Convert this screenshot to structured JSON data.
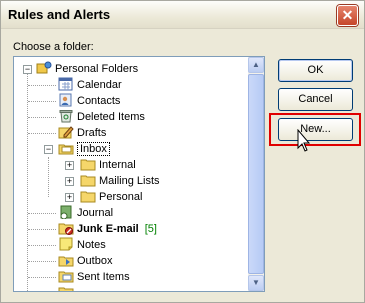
{
  "window": {
    "title": "Rules and Alerts"
  },
  "prompt": "Choose a folder:",
  "tree": {
    "root": "Personal Folders",
    "items": [
      {
        "label": "Calendar",
        "icon": "calendar-icon"
      },
      {
        "label": "Contacts",
        "icon": "contacts-icon"
      },
      {
        "label": "Deleted Items",
        "icon": "deleted-items-icon"
      },
      {
        "label": "Drafts",
        "icon": "drafts-icon"
      },
      {
        "label": "Inbox",
        "icon": "inbox-icon"
      },
      {
        "label": "Internal",
        "icon": "folder-icon"
      },
      {
        "label": "Mailing Lists",
        "icon": "folder-icon"
      },
      {
        "label": "Personal",
        "icon": "folder-icon"
      },
      {
        "label": "Journal",
        "icon": "journal-icon"
      },
      {
        "label": "Junk E-mail",
        "icon": "junk-email-icon",
        "count": "[5]"
      },
      {
        "label": "Notes",
        "icon": "notes-icon"
      },
      {
        "label": "Outbox",
        "icon": "outbox-icon"
      },
      {
        "label": "Sent Items",
        "icon": "sent-items-icon"
      }
    ]
  },
  "buttons": {
    "ok": "OK",
    "cancel": "Cancel",
    "new": "New..."
  },
  "colors": {
    "highlight": "#e00000",
    "count_green": "#008000",
    "folder_yellow": "#f5d66a"
  }
}
